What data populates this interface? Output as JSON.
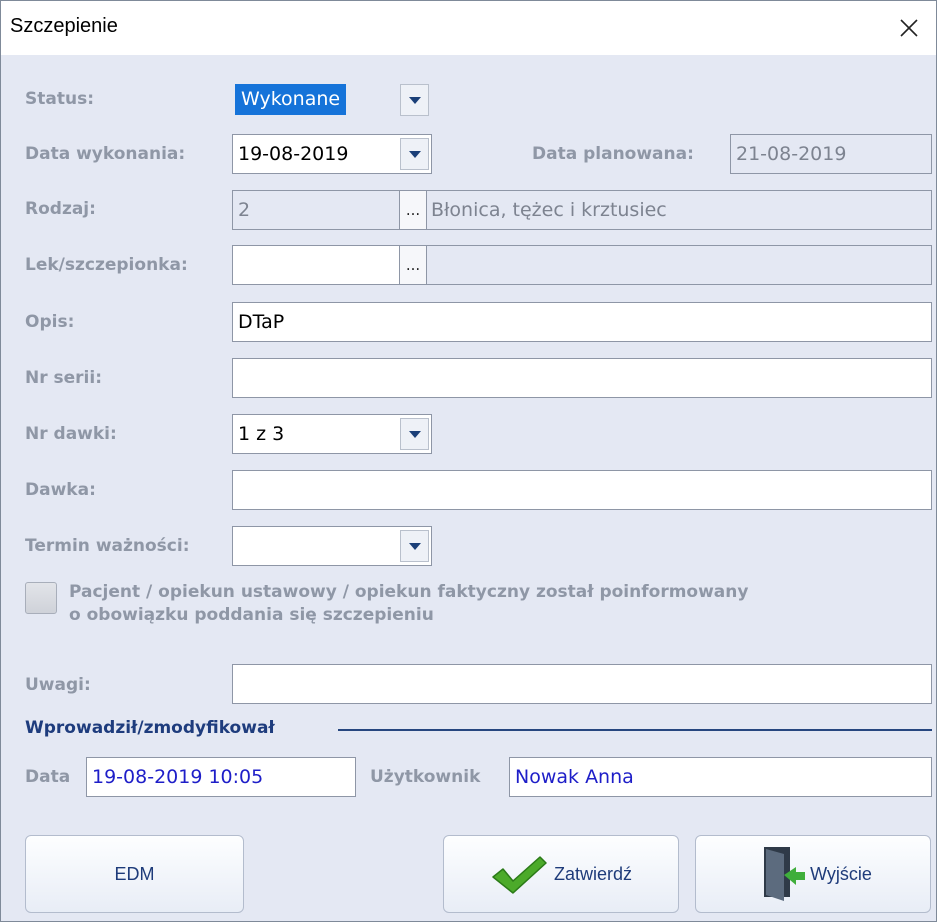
{
  "window": {
    "title": "Szczepienie"
  },
  "form": {
    "status": {
      "label": "Status:",
      "value": "Wykonane"
    },
    "data_wykonania": {
      "label": "Data wykonania:",
      "value": "19-08-2019"
    },
    "data_planowana": {
      "label": "Data planowana:",
      "value": "21-08-2019"
    },
    "rodzaj": {
      "label": "Rodzaj:",
      "code": "2",
      "button": "...",
      "description": "Błonica, tężec i krztusiec"
    },
    "lek": {
      "label": "Lek/szczepionka:",
      "code": "",
      "button": "...",
      "description": ""
    },
    "opis": {
      "label": "Opis:",
      "value": "DTaP"
    },
    "nr_serii": {
      "label": "Nr serii:",
      "value": ""
    },
    "nr_dawki": {
      "label": "Nr dawki:",
      "value": "1 z 3"
    },
    "dawka": {
      "label": "Dawka:",
      "value": ""
    },
    "termin": {
      "label": "Termin ważności:",
      "value": ""
    },
    "informed": {
      "line1": "Pacjent / opiekun ustawowy / opiekun faktyczny został poinformowany",
      "line2": "o obowiązku poddania się szczepieniu",
      "checked": false
    },
    "uwagi": {
      "label": "Uwagi:",
      "value": ""
    }
  },
  "modified": {
    "section_title": "Wprowadził/zmodyfikował",
    "data_label": "Data",
    "data_value": "19-08-2019 10:05",
    "user_label": "Użytkownik",
    "user_value": "Nowak Anna"
  },
  "buttons": {
    "edm": "EDM",
    "confirm": "Zatwierdź",
    "exit": "Wyjście"
  },
  "colors": {
    "label": "#8f97a6",
    "accent_blue": "#1e3c7d",
    "selection": "#1573d9",
    "value_blue": "#1e1ec8"
  }
}
